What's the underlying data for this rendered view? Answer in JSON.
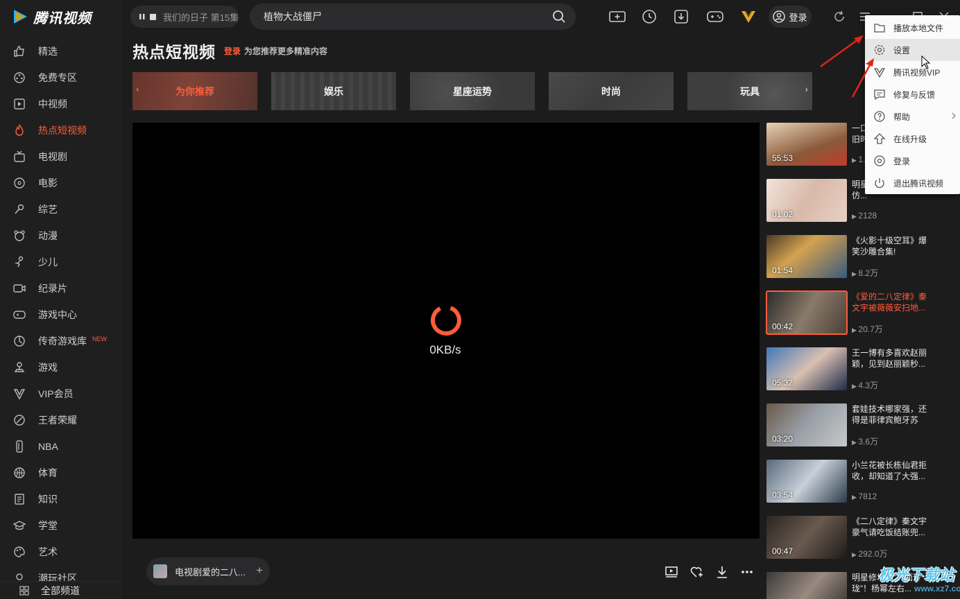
{
  "app": {
    "name": "腾讯视频",
    "brand_color": "#ff5c38"
  },
  "sidebar": {
    "items": [
      {
        "label": "精选",
        "icon": "thumbs-up-icon"
      },
      {
        "label": "免费专区",
        "icon": "film-reel-icon"
      },
      {
        "label": "中视频",
        "icon": "play-square-icon"
      },
      {
        "label": "热点短视频",
        "icon": "flame-icon",
        "active": true
      },
      {
        "label": "电视剧",
        "icon": "tv-icon"
      },
      {
        "label": "电影",
        "icon": "film-icon"
      },
      {
        "label": "综艺",
        "icon": "microphone-icon"
      },
      {
        "label": "动漫",
        "icon": "bear-icon"
      },
      {
        "label": "少儿",
        "icon": "child-icon"
      },
      {
        "label": "纪录片",
        "icon": "camera-icon"
      },
      {
        "label": "游戏中心",
        "icon": "gamepad-icon"
      },
      {
        "label": "传奇游戏库",
        "icon": "game-library-icon",
        "badge": "NEW"
      },
      {
        "label": "游戏",
        "icon": "joystick-icon"
      },
      {
        "label": "VIP会员",
        "icon": "vip-icon"
      },
      {
        "label": "王者荣耀",
        "icon": "honor-icon"
      },
      {
        "label": "NBA",
        "icon": "nba-icon"
      },
      {
        "label": "体育",
        "icon": "ball-icon"
      },
      {
        "label": "知识",
        "icon": "book-icon"
      },
      {
        "label": "学堂",
        "icon": "graduation-icon"
      },
      {
        "label": "艺术",
        "icon": "palette-icon"
      },
      {
        "label": "潮玩社区",
        "icon": "community-icon"
      }
    ],
    "all_channels": "全部频道"
  },
  "topbar": {
    "now_playing": "我们的日子 第15集",
    "search_value": "植物大战僵尸",
    "login_label": "登录"
  },
  "page": {
    "title": "热点短视频",
    "login_link": "登录",
    "login_hint": "为您推荐更多精准内容"
  },
  "categories": [
    "为你推荐",
    "娱乐",
    "星座运势",
    "时尚",
    "玩具"
  ],
  "player": {
    "speed": "0KB/s",
    "playlist_title": "电视剧爱的二八..."
  },
  "recommendations": [
    {
      "title": "一口气看完《你好，旧时光》穿越...",
      "duration": "55:53",
      "views": "1..."
    },
    {
      "title": "明星割韭菜，倪妮效仿...",
      "duration": "01:02",
      "views": "2128"
    },
    {
      "title": "《火影十级空耳》爆笑沙雕合集!",
      "duration": "01:54",
      "views": "8.2万"
    },
    {
      "title": "《爱的二八定律》秦文宇被薇薇安扫地...",
      "duration": "00:42",
      "views": "20.7万",
      "current": true
    },
    {
      "title": "王一博有多喜欢赵丽颖，见到赵丽颖秒...",
      "duration": "05:32",
      "views": "4.3万"
    },
    {
      "title": "套娃技术哪家强，还得是菲律宾鲍牙苏",
      "duration": "03:20",
      "views": "3.6万"
    },
    {
      "title": "小兰花被长栋仙君拒收，却知道了大强...",
      "duration": "03:54",
      "views": "7812"
    },
    {
      "title": "《二八定律》秦文宇豪气请吃饭结账兜...",
      "duration": "00:47",
      "views": "292.0万"
    },
    {
      "title": "明星修场的“八面玲珑”！杨幂左右...",
      "duration": "",
      "views": ""
    }
  ],
  "menu": [
    {
      "label": "播放本地文件",
      "icon": "folder-icon"
    },
    {
      "label": "设置",
      "icon": "gear-icon",
      "hover": true
    },
    {
      "label": "腾讯视频VIP",
      "icon": "vip-diamond-icon"
    },
    {
      "label": "修复与反馈",
      "icon": "feedback-icon"
    },
    {
      "label": "帮助",
      "icon": "help-icon",
      "submenu": true
    },
    {
      "label": "在线升级",
      "icon": "upgrade-icon"
    },
    {
      "label": "登录",
      "icon": "login-icon"
    },
    {
      "label": "退出腾讯视频",
      "icon": "power-icon"
    }
  ],
  "watermark": {
    "text": "极光下载站",
    "url": "www.xz7.com"
  }
}
